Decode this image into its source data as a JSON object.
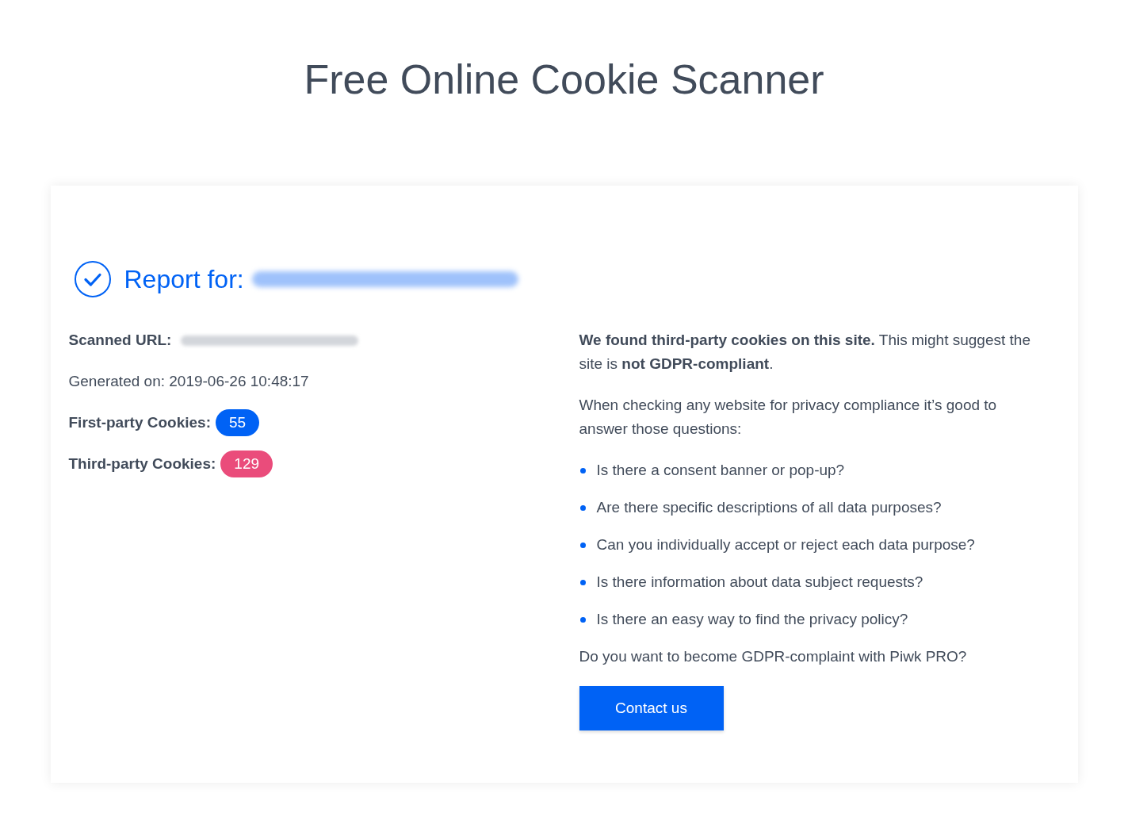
{
  "page_title": "Free Online Cookie Scanner",
  "report": {
    "heading": "Report for:",
    "details": {
      "scanned_url_label": "Scanned URL:",
      "generated": "Generated on: 2019-06-26 10:48:17",
      "counts": [
        {
          "label": "First-party Cookies:",
          "count": "55",
          "color": "#0062f5"
        },
        {
          "label": "Third-party Cookies:",
          "count": "129",
          "color": "#ea4c7b"
        }
      ]
    },
    "advice": {
      "verdict": "**We found third-party cookies on this site.** This might suggest the site is **not GDPR-compliant**.",
      "intro": "When checking any website for privacy compliance it’s good to answer those questions:",
      "questions": [
        "Is there a consent banner or pop-up?",
        "Are there specific descriptions of all data purposes?",
        "Can you individually accept or reject each data purpose?",
        "Is there information about data subject requests?",
        "Is there an easy way to find the privacy policy?"
      ],
      "closing": "Do you want to become GDPR-complaint with Piwk PRO?",
      "button": "Contact us"
    }
  }
}
